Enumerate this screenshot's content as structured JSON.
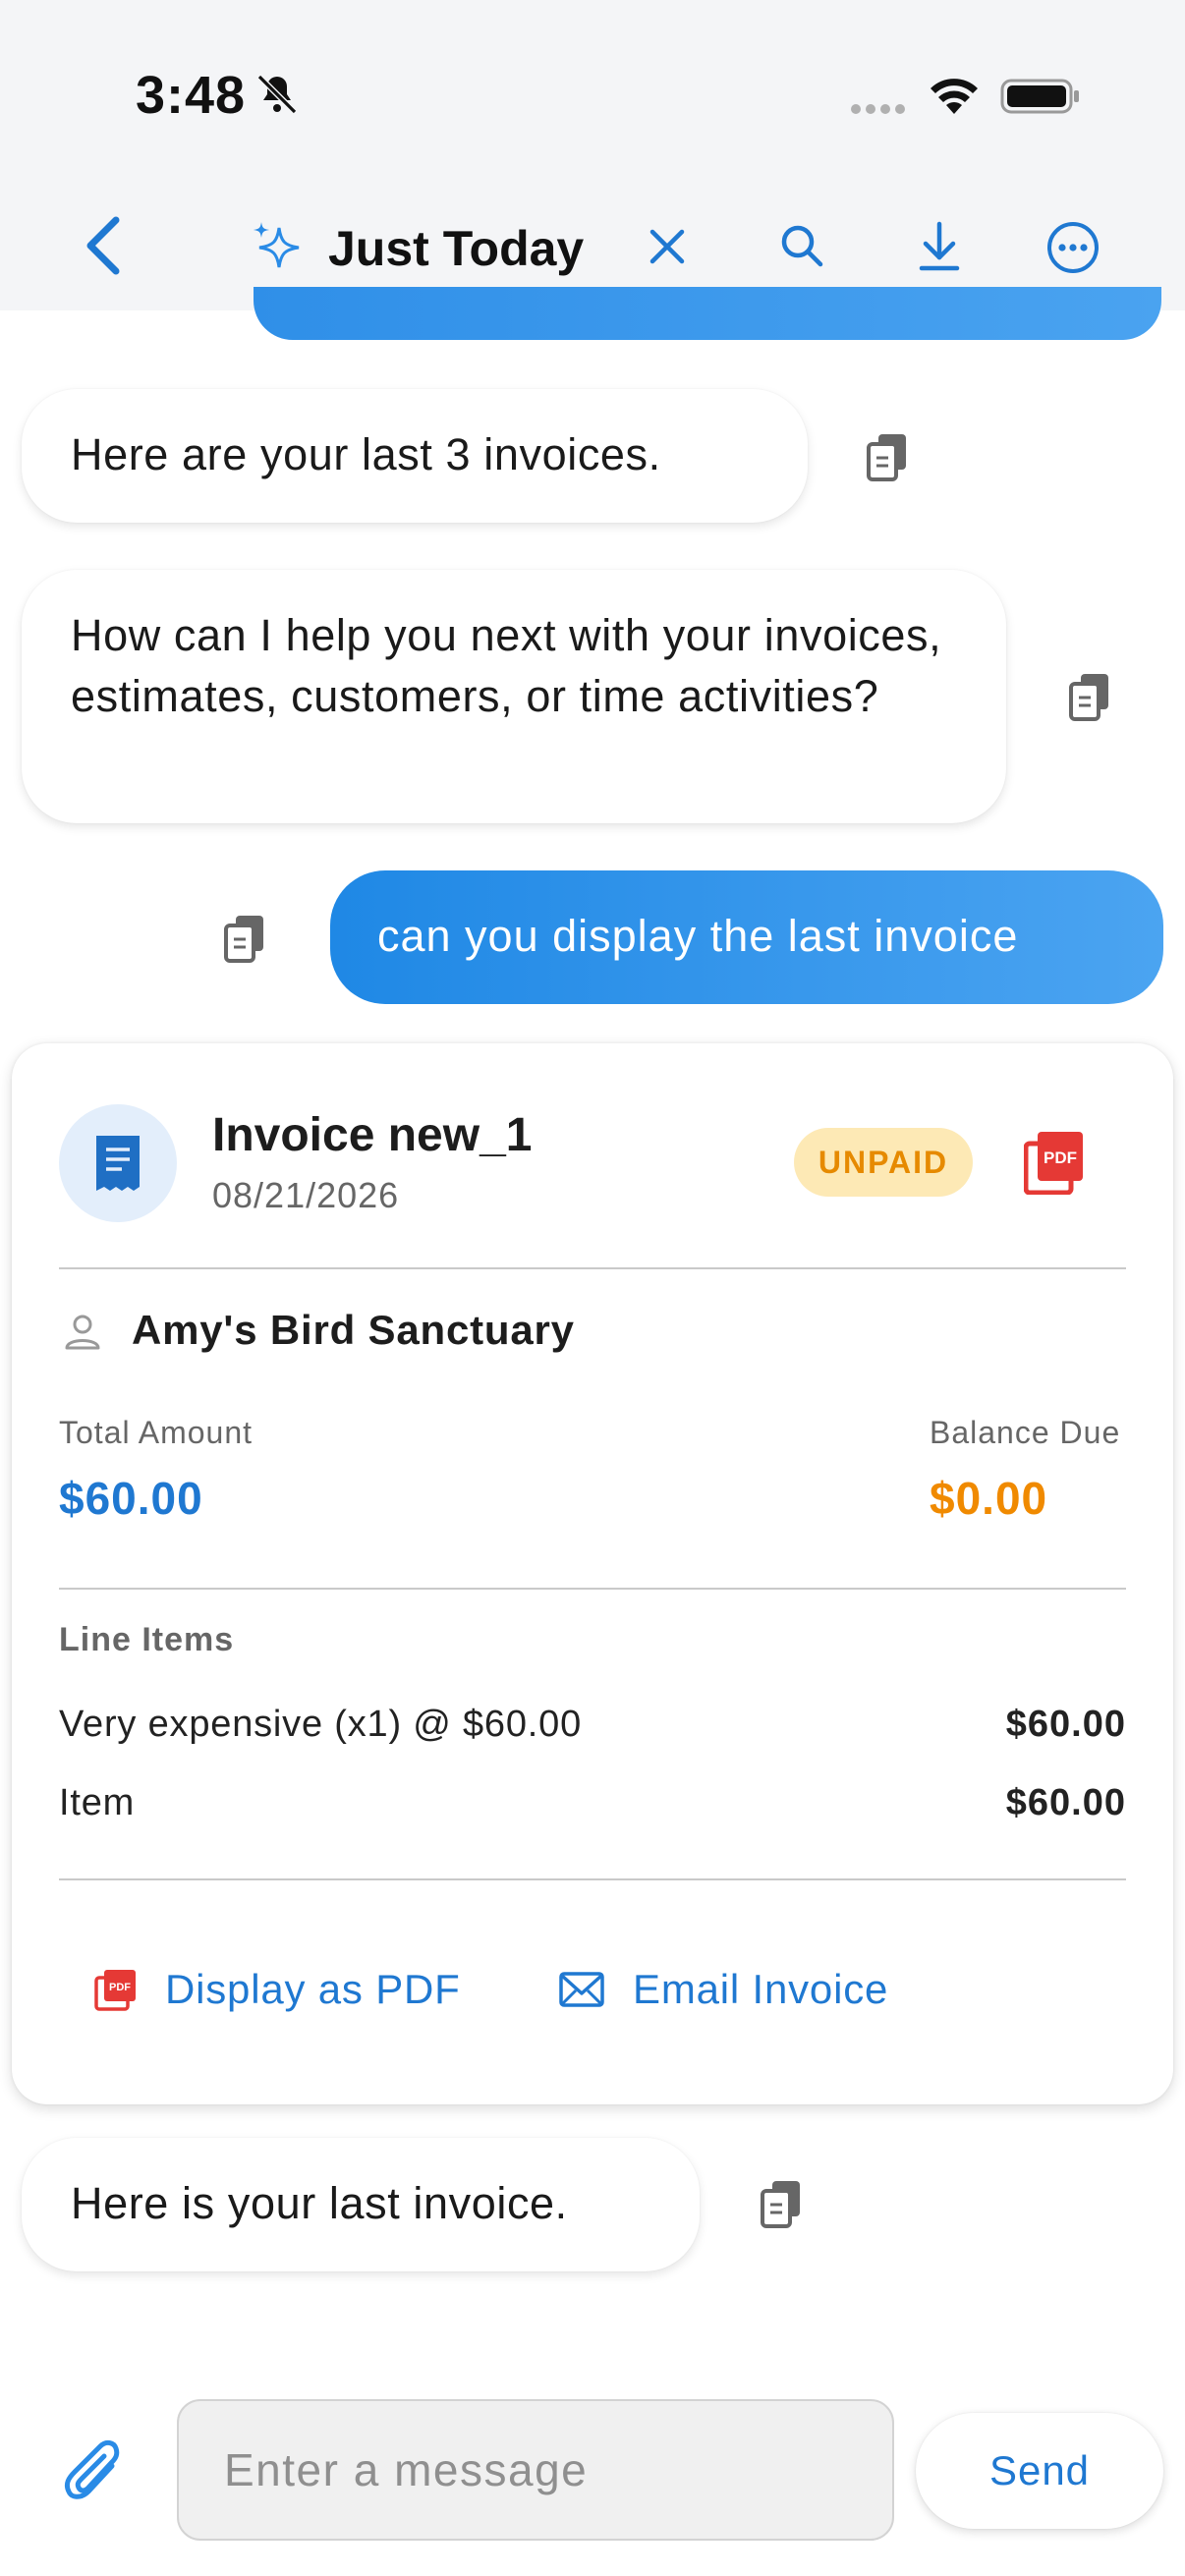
{
  "status_bar": {
    "time": "3:48",
    "icons": [
      "bell-slash-icon",
      "signal-dots-icon",
      "wifi-icon",
      "battery-icon"
    ]
  },
  "header": {
    "title": "Just Today",
    "icons": [
      "back-chevron-icon",
      "sparkle-icon",
      "close-icon",
      "search-icon",
      "download-icon",
      "more-icon"
    ]
  },
  "messages": [
    {
      "role": "assistant",
      "text": "Here are your last 3 invoices."
    },
    {
      "role": "assistant",
      "text": "How can I help you next with your invoices, estimates, customers, or time activities?"
    },
    {
      "role": "user",
      "text": "can you display the last invoice"
    },
    {
      "role": "assistant",
      "text": "Here is your last invoice."
    }
  ],
  "invoice": {
    "title": "Invoice new_1",
    "date": "08/21/2026",
    "status": "UNPAID",
    "customer": "Amy's Bird Sanctuary",
    "total_label": "Total Amount",
    "total_value": "$60.00",
    "balance_label": "Balance Due",
    "balance_value": "$0.00",
    "line_items_heading": "Line Items",
    "line_items": [
      {
        "description": "Very expensive (x1) @ $60.00",
        "amount": "$60.00"
      },
      {
        "description": "Item",
        "amount": "$60.00"
      }
    ],
    "actions": {
      "pdf_label": "Display as PDF",
      "email_label": "Email Invoice"
    }
  },
  "composer": {
    "placeholder": "Enter a message",
    "send_label": "Send"
  },
  "colors": {
    "accent": "#1f78d1",
    "user_bubble": "#2f8fe8",
    "unpaid_bg": "#fde9b5",
    "unpaid_text": "#e68a00",
    "balance": "#f08a00",
    "pdf_red": "#e53935"
  }
}
